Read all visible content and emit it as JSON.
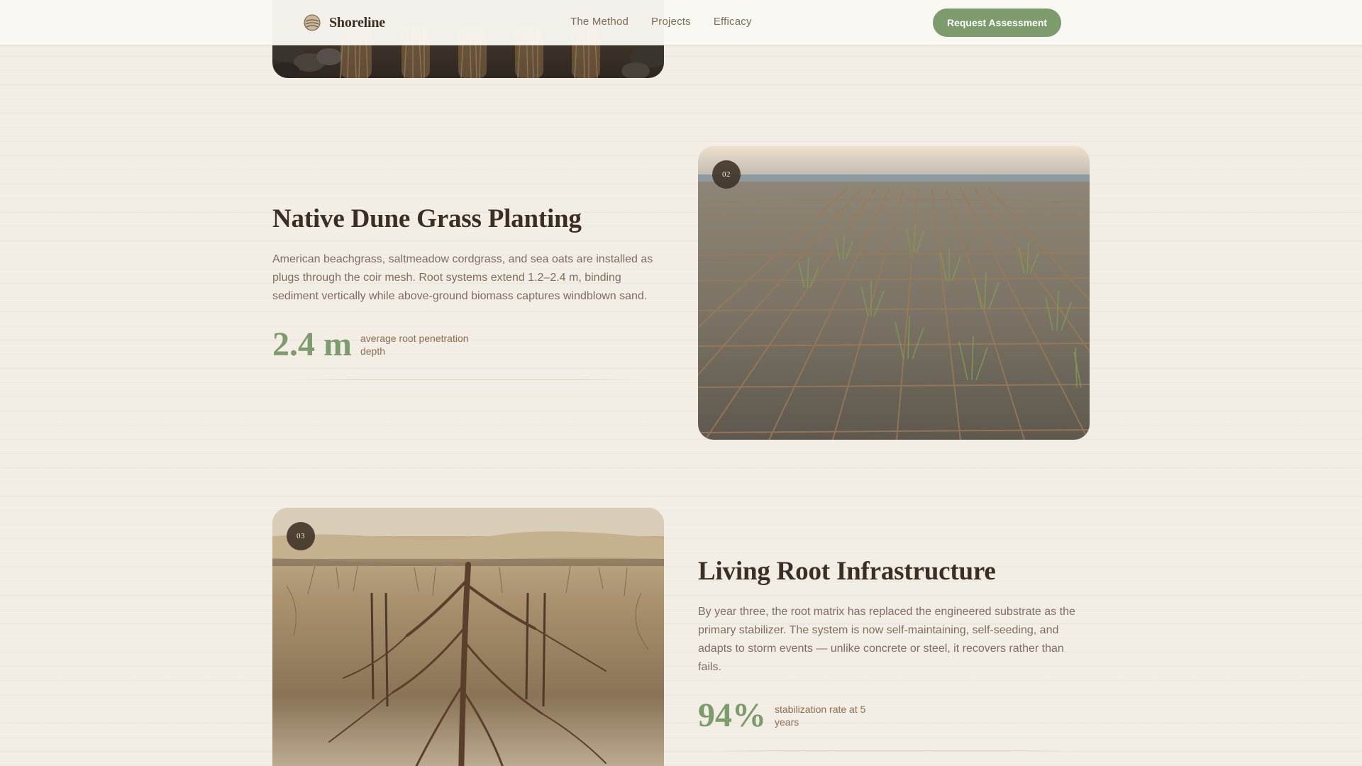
{
  "brand": {
    "name": "Shoreline",
    "logo_icon": "shell-logo-icon"
  },
  "nav": {
    "items": [
      {
        "label": "The Method"
      },
      {
        "label": "Projects"
      },
      {
        "label": "Efficacy"
      }
    ],
    "cta_label": "Request Assessment"
  },
  "colors": {
    "background": "#f2ede5",
    "accent_green": "#7d9b6c",
    "heading_brown": "#3a2f22",
    "body_text": "#7d6f60",
    "badge_bg": "#3c3024"
  },
  "sections": [
    {
      "step": "02",
      "title": "Native Dune Grass Planting",
      "body": "American beachgrass, saltmeadow cordgrass, and sea oats are installed as plugs through the coir mesh. Root systems extend 1.2–2.4 m, binding sediment vertically while above-ground biomass captures windblown sand.",
      "stat_value": "2.4 m",
      "stat_label": "average root penetration depth"
    },
    {
      "step": "03",
      "title": "Living Root Infrastructure",
      "body": "By year three, the root matrix has replaced the engineered substrate as the primary stabilizer. The system is now self-maintaining, self-seeding, and adapts to storm events — unlike concrete or steel, it recovers rather than fails.",
      "stat_value": "94%",
      "stat_label": "stabilization rate at 5 years"
    }
  ]
}
